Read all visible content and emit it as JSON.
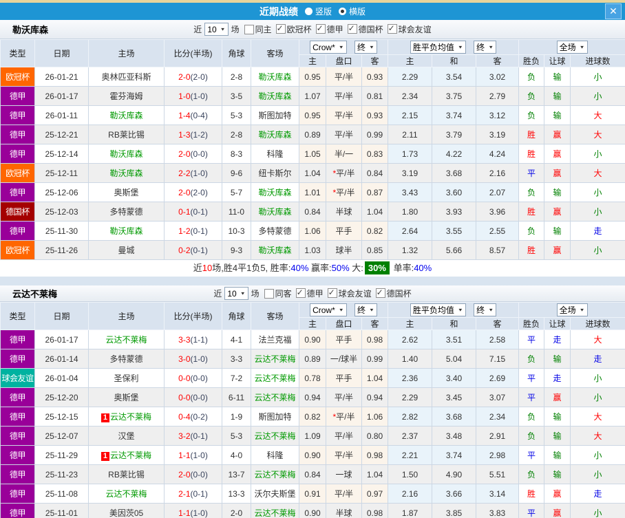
{
  "titlebar": {
    "title": "近期战绩",
    "radios": [
      {
        "label": "竖版",
        "selected": false
      },
      {
        "label": "横版",
        "selected": true
      }
    ],
    "close_glyph": "✕"
  },
  "filter": {
    "recent_label": "近",
    "count_value": "10",
    "matches_label": "场"
  },
  "table_header": {
    "type": "类型",
    "date": "日期",
    "home": "主场",
    "score": "比分(半场)",
    "corner": "角球",
    "away": "客场",
    "odds_group": {
      "select1": "Crow*",
      "select2": "终",
      "sub": [
        "主",
        "盘口",
        "客"
      ]
    },
    "avg_group": {
      "select1": "胜平负均值",
      "select2": "终",
      "sub": [
        "主",
        "和",
        "客"
      ]
    },
    "result_group": {
      "select": "全场",
      "sub": [
        "胜负",
        "让球",
        "进球数"
      ]
    }
  },
  "colors": {
    "type_colors": {
      "欧冠杯": "#ff6600",
      "德甲": "#990099",
      "德国杯": "#a40000",
      "球会友谊": "#00b2a0"
    },
    "accent_blue": "#1e95d4",
    "highlight_green": "#009900",
    "score_red": "#ff0000"
  },
  "sections": [
    {
      "team": "勒沃库森",
      "same": {
        "label": "同主",
        "checked": false
      },
      "leagues": [
        {
          "label": "欧冠杯",
          "checked": true
        },
        {
          "label": "德甲",
          "checked": true
        },
        {
          "label": "德国杯",
          "checked": true
        },
        {
          "label": "球会友谊",
          "checked": true
        }
      ],
      "rows": [
        {
          "type": "欧冠杯",
          "date": "26-01-21",
          "home": "奥林匹亚科斯",
          "home_hl": false,
          "home_mark": false,
          "score": "2-0",
          "half": "(2-0)",
          "corner": "2-8",
          "away": "勒沃库森",
          "away_hl": true,
          "w1": "0.95",
          "star": false,
          "handicap": "平/半",
          "w2": "0.93",
          "avg_h": "2.29",
          "avg_d": "3.54",
          "avg_a": "3.02",
          "res": "负",
          "rlet": "输",
          "rgoal": "小"
        },
        {
          "type": "德甲",
          "date": "26-01-17",
          "home": "霍芬海姆",
          "home_hl": false,
          "home_mark": false,
          "score": "1-0",
          "half": "(1-0)",
          "corner": "3-5",
          "away": "勒沃库森",
          "away_hl": true,
          "w1": "1.07",
          "star": false,
          "handicap": "平/半",
          "w2": "0.81",
          "avg_h": "2.34",
          "avg_d": "3.75",
          "avg_a": "2.79",
          "res": "负",
          "rlet": "输",
          "rgoal": "小"
        },
        {
          "type": "德甲",
          "date": "26-01-11",
          "home": "勒沃库森",
          "home_hl": true,
          "home_mark": false,
          "score": "1-4",
          "half": "(0-4)",
          "corner": "5-3",
          "away": "斯图加特",
          "away_hl": false,
          "w1": "0.95",
          "star": false,
          "handicap": "平/半",
          "w2": "0.93",
          "avg_h": "2.15",
          "avg_d": "3.74",
          "avg_a": "3.12",
          "res": "负",
          "rlet": "输",
          "rgoal": "大"
        },
        {
          "type": "德甲",
          "date": "25-12-21",
          "home": "RB莱比锡",
          "home_hl": false,
          "home_mark": false,
          "score": "1-3",
          "half": "(1-2)",
          "corner": "2-8",
          "away": "勒沃库森",
          "away_hl": true,
          "w1": "0.89",
          "star": false,
          "handicap": "平/半",
          "w2": "0.99",
          "avg_h": "2.11",
          "avg_d": "3.79",
          "avg_a": "3.19",
          "res": "胜",
          "rlet": "赢",
          "rgoal": "大"
        },
        {
          "type": "德甲",
          "date": "25-12-14",
          "home": "勒沃库森",
          "home_hl": true,
          "home_mark": false,
          "score": "2-0",
          "half": "(0-0)",
          "corner": "8-3",
          "away": "科隆",
          "away_hl": false,
          "w1": "1.05",
          "star": false,
          "handicap": "半/一",
          "w2": "0.83",
          "avg_h": "1.73",
          "avg_d": "4.22",
          "avg_a": "4.24",
          "res": "胜",
          "rlet": "赢",
          "rgoal": "小"
        },
        {
          "type": "欧冠杯",
          "date": "25-12-11",
          "home": "勒沃库森",
          "home_hl": true,
          "home_mark": false,
          "score": "2-2",
          "half": "(1-0)",
          "corner": "9-6",
          "away": "纽卡斯尔",
          "away_hl": false,
          "w1": "1.04",
          "star": true,
          "handicap": "平/半",
          "w2": "0.84",
          "avg_h": "3.19",
          "avg_d": "3.68",
          "avg_a": "2.16",
          "res": "平",
          "rlet": "赢",
          "rgoal": "大"
        },
        {
          "type": "德甲",
          "date": "25-12-06",
          "home": "奥斯堡",
          "home_hl": false,
          "home_mark": false,
          "score": "2-0",
          "half": "(2-0)",
          "corner": "5-7",
          "away": "勒沃库森",
          "away_hl": true,
          "w1": "1.01",
          "star": true,
          "handicap": "平/半",
          "w2": "0.87",
          "avg_h": "3.43",
          "avg_d": "3.60",
          "avg_a": "2.07",
          "res": "负",
          "rlet": "输",
          "rgoal": "小"
        },
        {
          "type": "德国杯",
          "date": "25-12-03",
          "home": "多特蒙德",
          "home_hl": false,
          "home_mark": false,
          "score": "0-1",
          "half": "(0-1)",
          "corner": "11-0",
          "away": "勒沃库森",
          "away_hl": true,
          "w1": "0.84",
          "star": false,
          "handicap": "半球",
          "w2": "1.04",
          "avg_h": "1.80",
          "avg_d": "3.93",
          "avg_a": "3.96",
          "res": "胜",
          "rlet": "赢",
          "rgoal": "小"
        },
        {
          "type": "德甲",
          "date": "25-11-30",
          "home": "勒沃库森",
          "home_hl": true,
          "home_mark": false,
          "score": "1-2",
          "half": "(0-1)",
          "corner": "10-3",
          "away": "多特蒙德",
          "away_hl": false,
          "w1": "1.06",
          "star": false,
          "handicap": "平手",
          "w2": "0.82",
          "avg_h": "2.64",
          "avg_d": "3.55",
          "avg_a": "2.55",
          "res": "负",
          "rlet": "输",
          "rgoal": "走"
        },
        {
          "type": "欧冠杯",
          "date": "25-11-26",
          "home": "曼城",
          "home_hl": false,
          "home_mark": false,
          "score": "0-2",
          "half": "(0-1)",
          "corner": "9-3",
          "away": "勒沃库森",
          "away_hl": true,
          "w1": "1.03",
          "star": false,
          "handicap": "球半",
          "w2": "0.85",
          "avg_h": "1.32",
          "avg_d": "5.66",
          "avg_a": "8.57",
          "res": "胜",
          "rlet": "赢",
          "rgoal": "小"
        }
      ],
      "summary_segments": [
        {
          "text": "近",
          "style": "k"
        },
        {
          "text": "10",
          "style": "r"
        },
        {
          "text": "场,胜4平1负5, 胜率:",
          "style": "k"
        },
        {
          "text": "40%",
          "style": "b"
        },
        {
          "text": " 赢率:",
          "style": "k"
        },
        {
          "text": "50%",
          "style": "b"
        },
        {
          "text": " 大:",
          "style": "k"
        },
        {
          "text": "30%",
          "style": "gb"
        },
        {
          "text": " 单率:",
          "style": "k"
        },
        {
          "text": "40%",
          "style": "b"
        }
      ]
    },
    {
      "team": "云达不莱梅",
      "same": {
        "label": "同客",
        "checked": false
      },
      "leagues": [
        {
          "label": "德甲",
          "checked": true
        },
        {
          "label": "球会友谊",
          "checked": true
        },
        {
          "label": "德国杯",
          "checked": true
        }
      ],
      "rows": [
        {
          "type": "德甲",
          "date": "26-01-17",
          "home": "云达不莱梅",
          "home_hl": true,
          "home_mark": false,
          "score": "3-3",
          "half": "(1-1)",
          "corner": "4-1",
          "away": "法兰克福",
          "away_hl": false,
          "w1": "0.90",
          "star": false,
          "handicap": "平手",
          "w2": "0.98",
          "avg_h": "2.62",
          "avg_d": "3.51",
          "avg_a": "2.58",
          "res": "平",
          "rlet": "走",
          "rgoal": "大"
        },
        {
          "type": "德甲",
          "date": "26-01-14",
          "home": "多特蒙德",
          "home_hl": false,
          "home_mark": false,
          "score": "3-0",
          "half": "(1-0)",
          "corner": "3-3",
          "away": "云达不莱梅",
          "away_hl": true,
          "w1": "0.89",
          "star": false,
          "handicap": "一/球半",
          "w2": "0.99",
          "avg_h": "1.40",
          "avg_d": "5.04",
          "avg_a": "7.15",
          "res": "负",
          "rlet": "输",
          "rgoal": "走"
        },
        {
          "type": "球会友谊",
          "date": "26-01-04",
          "home": "圣保利",
          "home_hl": false,
          "home_mark": false,
          "score": "0-0",
          "half": "(0-0)",
          "corner": "7-2",
          "away": "云达不莱梅",
          "away_hl": true,
          "w1": "0.78",
          "star": false,
          "handicap": "平手",
          "w2": "1.04",
          "avg_h": "2.36",
          "avg_d": "3.40",
          "avg_a": "2.69",
          "res": "平",
          "rlet": "走",
          "rgoal": "小"
        },
        {
          "type": "德甲",
          "date": "25-12-20",
          "home": "奥斯堡",
          "home_hl": false,
          "home_mark": false,
          "score": "0-0",
          "half": "(0-0)",
          "corner": "6-11",
          "away": "云达不莱梅",
          "away_hl": true,
          "w1": "0.94",
          "star": false,
          "handicap": "平/半",
          "w2": "0.94",
          "avg_h": "2.29",
          "avg_d": "3.45",
          "avg_a": "3.07",
          "res": "平",
          "rlet": "赢",
          "rgoal": "小"
        },
        {
          "type": "德甲",
          "date": "25-12-15",
          "home": "云达不莱梅",
          "home_hl": true,
          "home_mark": true,
          "score": "0-4",
          "half": "(0-2)",
          "corner": "1-9",
          "away": "斯图加特",
          "away_hl": false,
          "w1": "0.82",
          "star": true,
          "handicap": "平/半",
          "w2": "1.06",
          "avg_h": "2.82",
          "avg_d": "3.68",
          "avg_a": "2.34",
          "res": "负",
          "rlet": "输",
          "rgoal": "大"
        },
        {
          "type": "德甲",
          "date": "25-12-07",
          "home": "汉堡",
          "home_hl": false,
          "home_mark": false,
          "score": "3-2",
          "half": "(0-1)",
          "corner": "5-3",
          "away": "云达不莱梅",
          "away_hl": true,
          "w1": "1.09",
          "star": false,
          "handicap": "平/半",
          "w2": "0.80",
          "avg_h": "2.37",
          "avg_d": "3.48",
          "avg_a": "2.91",
          "res": "负",
          "rlet": "输",
          "rgoal": "大"
        },
        {
          "type": "德甲",
          "date": "25-11-29",
          "home": "云达不莱梅",
          "home_hl": true,
          "home_mark": true,
          "score": "1-1",
          "half": "(1-0)",
          "corner": "4-0",
          "away": "科隆",
          "away_hl": false,
          "w1": "0.90",
          "star": false,
          "handicap": "平/半",
          "w2": "0.98",
          "avg_h": "2.21",
          "avg_d": "3.74",
          "avg_a": "2.98",
          "res": "平",
          "rlet": "输",
          "rgoal": "小"
        },
        {
          "type": "德甲",
          "date": "25-11-23",
          "home": "RB莱比锡",
          "home_hl": false,
          "home_mark": false,
          "score": "2-0",
          "half": "(0-0)",
          "corner": "13-7",
          "away": "云达不莱梅",
          "away_hl": true,
          "w1": "0.84",
          "star": false,
          "handicap": "一球",
          "w2": "1.04",
          "avg_h": "1.50",
          "avg_d": "4.90",
          "avg_a": "5.51",
          "res": "负",
          "rlet": "输",
          "rgoal": "小"
        },
        {
          "type": "德甲",
          "date": "25-11-08",
          "home": "云达不莱梅",
          "home_hl": true,
          "home_mark": false,
          "score": "2-1",
          "half": "(0-1)",
          "corner": "13-3",
          "away": "沃尔夫斯堡",
          "away_hl": false,
          "w1": "0.91",
          "star": false,
          "handicap": "平/半",
          "w2": "0.97",
          "avg_h": "2.16",
          "avg_d": "3.66",
          "avg_a": "3.14",
          "res": "胜",
          "rlet": "赢",
          "rgoal": "走"
        },
        {
          "type": "德甲",
          "date": "25-11-01",
          "home": "美因茨05",
          "home_hl": false,
          "home_mark": false,
          "score": "1-1",
          "half": "(1-0)",
          "corner": "2-0",
          "away": "云达不莱梅",
          "away_hl": true,
          "w1": "0.90",
          "star": false,
          "handicap": "半球",
          "w2": "0.98",
          "avg_h": "1.87",
          "avg_d": "3.85",
          "avg_a": "3.83",
          "res": "平",
          "rlet": "赢",
          "rgoal": "小"
        }
      ]
    }
  ]
}
